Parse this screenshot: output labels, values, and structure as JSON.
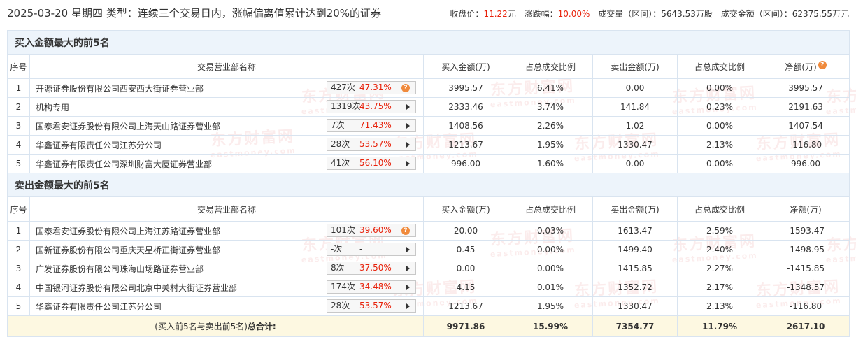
{
  "header": {
    "title": "2025-03-20 星期四 类型：连续三个交易日内，涨幅偏离值累计达到20%的证券",
    "close_label": "收盘价：",
    "close_value": "11.22",
    "close_unit": "元",
    "change_label": "涨跌幅：",
    "change_value": "10.00%",
    "volume_label": "成交量（区间）：",
    "volume_value": "5643.53万股",
    "amount_label": "成交金额（区间）：",
    "amount_value": "62375.55万元"
  },
  "watermark": {
    "cn": "东方财富网",
    "en": "eastmoney.com"
  },
  "columns": {
    "seq": "序号",
    "dept": "交易营业部名称",
    "buy": "买入金额(万)",
    "buy_ratio": "占总成交比例",
    "sell": "卖出金额(万)",
    "sell_ratio": "占总成交比例",
    "net_buy_table": "净额(万)",
    "net_sell_table": "净额(万)"
  },
  "buy_section": {
    "title": "买入金额最大的前5名",
    "rows": [
      {
        "seq": "1",
        "name": "开源证券股份有限公司西安西大街证券营业部",
        "times": "427次",
        "rate": "47.31%",
        "buy": "3995.57",
        "buy_ratio": "6.41%",
        "sell": "0.00",
        "sell_ratio": "0.00%",
        "net": "3995.57"
      },
      {
        "seq": "2",
        "name": "机构专用",
        "times": "1319次",
        "rate": "43.75%",
        "buy": "2333.46",
        "buy_ratio": "3.74%",
        "sell": "141.84",
        "sell_ratio": "0.23%",
        "net": "2191.63"
      },
      {
        "seq": "3",
        "name": "国泰君安证券股份有限公司上海天山路证券营业部",
        "times": "7次",
        "rate": "71.43%",
        "buy": "1408.56",
        "buy_ratio": "2.26%",
        "sell": "1.02",
        "sell_ratio": "0.00%",
        "net": "1407.54"
      },
      {
        "seq": "4",
        "name": "华鑫证券有限责任公司江苏分公司",
        "times": "28次",
        "rate": "53.57%",
        "buy": "1213.67",
        "buy_ratio": "1.95%",
        "sell": "1330.47",
        "sell_ratio": "2.13%",
        "net": "-116.80"
      },
      {
        "seq": "5",
        "name": "华鑫证券有限责任公司深圳财富大厦证券营业部",
        "times": "41次",
        "rate": "56.10%",
        "buy": "996.00",
        "buy_ratio": "1.60%",
        "sell": "0.00",
        "sell_ratio": "0.00%",
        "net": "996.00"
      }
    ]
  },
  "sell_section": {
    "title": "卖出金额最大的前5名",
    "rows": [
      {
        "seq": "1",
        "name": "国泰君安证券股份有限公司上海江苏路证券营业部",
        "times": "101次",
        "rate": "39.60%",
        "buy": "20.00",
        "buy_ratio": "0.03%",
        "sell": "1613.47",
        "sell_ratio": "2.59%",
        "net": "-1593.47"
      },
      {
        "seq": "2",
        "name": "国新证券股份有限公司重庆天星桥正街证券营业部",
        "times": "-次",
        "rate": "-",
        "buy": "0.45",
        "buy_ratio": "0.00%",
        "sell": "1499.40",
        "sell_ratio": "2.40%",
        "net": "-1498.95"
      },
      {
        "seq": "3",
        "name": "广发证券股份有限公司珠海山场路证券营业部",
        "times": "8次",
        "rate": "37.50%",
        "buy": "0.00",
        "buy_ratio": "0.00%",
        "sell": "1415.85",
        "sell_ratio": "2.27%",
        "net": "-1415.85"
      },
      {
        "seq": "4",
        "name": "中国银河证券股份有限公司北京中关村大街证券营业部",
        "times": "174次",
        "rate": "34.48%",
        "buy": "4.15",
        "buy_ratio": "0.01%",
        "sell": "1352.72",
        "sell_ratio": "2.17%",
        "net": "-1348.57"
      },
      {
        "seq": "5",
        "name": "华鑫证券有限责任公司江苏分公司",
        "times": "28次",
        "rate": "53.57%",
        "buy": "1213.67",
        "buy_ratio": "1.95%",
        "sell": "1330.47",
        "sell_ratio": "2.13%",
        "net": "-116.80"
      }
    ]
  },
  "total": {
    "label_prefix": "(买入前5名与卖出前5名)",
    "label_bold": "总合计:",
    "buy": "9971.86",
    "buy_ratio": "15.99%",
    "sell": "7354.77",
    "sell_ratio": "11.79%",
    "net": "2617.10"
  },
  "colors": {
    "red": "#e8220b",
    "green": "#11a00f",
    "section_bg": "#edf4fb",
    "total_bg": "#fdf8e1",
    "help_icon": "#f08a3c"
  }
}
